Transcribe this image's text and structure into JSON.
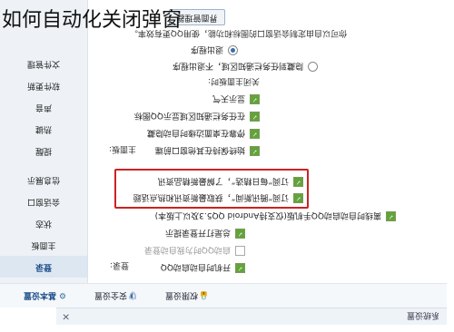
{
  "caption": "如何自动化关闭弹窗",
  "window": {
    "title": "系统设置",
    "close_glyph": "×"
  },
  "tabs": [
    {
      "label": "基本设置",
      "icon": "gear-icon",
      "glyph": "⚙",
      "active": true
    },
    {
      "label": "安全设置",
      "icon": "shield-icon",
      "glyph": "🛡",
      "active": false
    },
    {
      "label": "权限设置",
      "icon": "lock-icon",
      "glyph": "🔒",
      "active": false
    }
  ],
  "sidebar": {
    "items": [
      {
        "label": "登录",
        "active": true
      },
      {
        "label": "主面板",
        "active": false
      },
      {
        "label": "状态",
        "active": false
      },
      {
        "label": "会话窗口",
        "active": false
      },
      {
        "label": "信息展示",
        "active": false
      },
      {
        "label": "提醒",
        "active": false
      },
      {
        "label": "热键",
        "active": false
      },
      {
        "label": "声音",
        "active": false
      },
      {
        "label": "软件更新",
        "active": false
      },
      {
        "label": "文件管理",
        "active": false
      }
    ]
  },
  "sections": {
    "login": "登录:",
    "main_panel": "主面板:"
  },
  "login_options": [
    {
      "label": "开机时自动启动QQ",
      "checked": true
    },
    {
      "label": "启动QQ时为我自动登录",
      "checked": false,
      "dim": true
    },
    {
      "label": "总是打开登录提示",
      "checked": true
    },
    {
      "label": "离线时自动启动QQ手机版(仅支持Android QQ5.3及以上版本)",
      "checked": true
    },
    {
      "label": "订阅“腾讯新闻”，获取最新资讯和热点话题",
      "checked": true,
      "highlight": true
    },
    {
      "label": "订阅“每日精选”，了解最新精品资讯",
      "checked": true,
      "highlight": true
    }
  ],
  "panel_options": [
    {
      "label": "始终保持在其他窗口前端",
      "checked": true
    },
    {
      "label": "停靠在桌面边缘时自动隐藏",
      "checked": true
    },
    {
      "label": "在任务栏通知区域显示QQ图标",
      "checked": true
    },
    {
      "label": "显示天气",
      "checked": true
    }
  ],
  "close_panel": {
    "label": "关闭主面板时:",
    "options": [
      {
        "label": "隐藏到任务栏通知区域，不退出程序",
        "selected": false
      },
      {
        "label": "退出程序",
        "selected": true
      }
    ]
  },
  "note": "你可以自由定制会话窗口的图标和功能，使用QQ更有效率。",
  "manage_button": "界面管理器"
}
